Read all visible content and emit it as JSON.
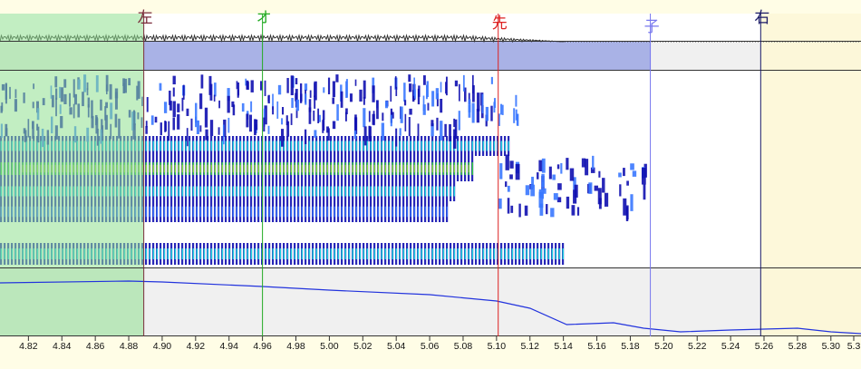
{
  "axis": {
    "unit": "s",
    "view_start": 4.803,
    "view_end": 5.318,
    "ticks": [
      "4.82",
      "4.84",
      "4.86",
      "4.88",
      "4.90",
      "4.92",
      "4.94",
      "4.96",
      "4.98",
      "5.00",
      "5.02",
      "5.04",
      "5.06",
      "5.08",
      "5.10",
      "5.12",
      "5.14",
      "5.16",
      "5.18",
      "5.20",
      "5.22",
      "5.24",
      "5.26",
      "5.28",
      "5.30",
      "5.3"
    ]
  },
  "selection": {
    "start": 4.803,
    "end": 4.889
  },
  "markers": [
    {
      "label": "左",
      "time": 4.889,
      "color": "#7a2b3a"
    },
    {
      "label": "オ",
      "time": 4.96,
      "color": "#22aa22"
    },
    {
      "label": "先",
      "time": 5.101,
      "color": "#dd2222"
    },
    {
      "label": "子",
      "time": 5.192,
      "color": "#7777ee"
    },
    {
      "label": "右",
      "time": 5.258,
      "color": "#1a1a66"
    }
  ],
  "colors": {
    "background": "#fffde6",
    "panel_bg": "#f0f0f0",
    "selection_fill": "#8fe08f",
    "waveform_band": "#a9b2e6",
    "spectrogram_dark": "#1010b0",
    "spectrogram_mid": "#3a78ff",
    "spectrogram_cyan": "#22e0e0",
    "spectrogram_green": "#3cdc3c",
    "pitch_line": "#2233dd",
    "right_region": "#fdf7d6"
  }
}
